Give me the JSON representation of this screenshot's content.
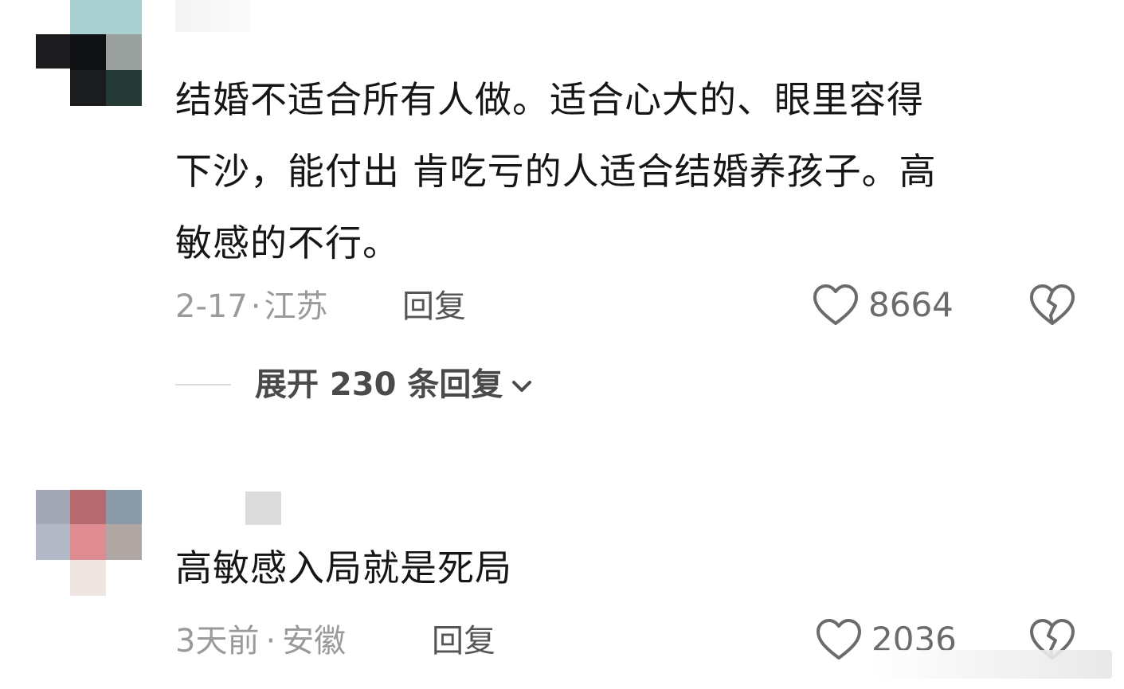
{
  "comments": [
    {
      "text_lines": [
        "结婚不适合所有人做。适合心大的、眼里容得",
        "下沙，能付出 肯吃亏的人适合结婚养孩子。高",
        "敏感的不行。"
      ],
      "date": "2-17",
      "separator": "·",
      "location": "江苏",
      "reply_label": "回复",
      "like_count": "8664",
      "expand_label": "展开 230 条回复"
    },
    {
      "text_lines": [
        "高敏感入局就是死局"
      ],
      "date": "3天前",
      "separator": "·",
      "location": "安徽",
      "reply_label": "回复",
      "like_count": "2036"
    }
  ],
  "icons": {
    "like": "heart-outline-icon",
    "dislike": "broken-heart-icon",
    "expand": "chevron-down-icon"
  },
  "colors": {
    "text": "#161616",
    "meta": "#9a9a9a",
    "icon": "#6b6b6b"
  }
}
